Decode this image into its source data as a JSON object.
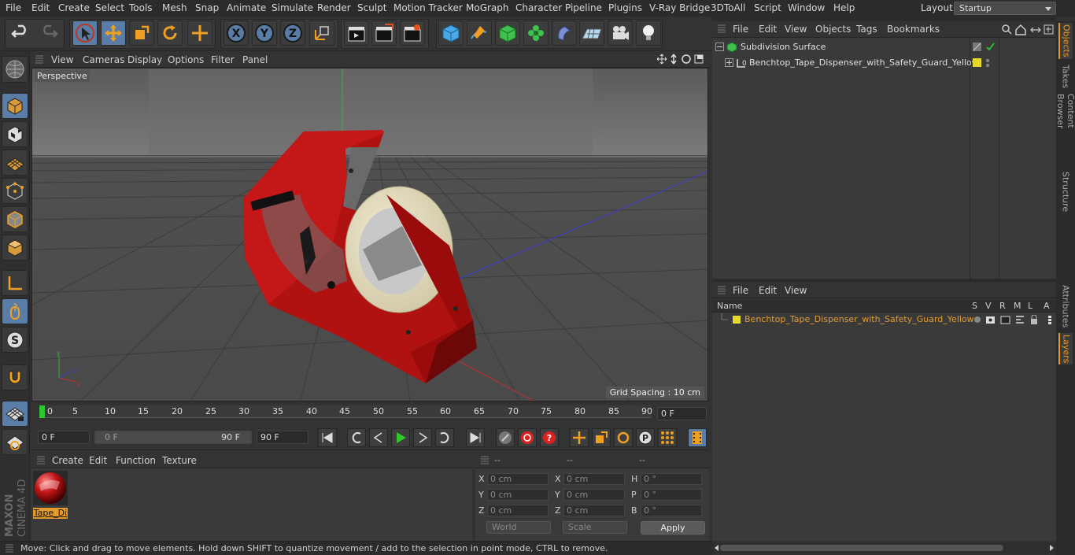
{
  "menubar": {
    "items": [
      "File",
      "Edit",
      "Create",
      "Select",
      "Tools",
      "Mesh",
      "Snap",
      "Animate",
      "Simulate",
      "Render",
      "Sculpt",
      "Motion Tracker",
      "MoGraph",
      "Character",
      "Pipeline",
      "Plugins",
      "V-Ray Bridge",
      "3DToAll",
      "Script",
      "Window",
      "Help"
    ],
    "layout_label": "Layout:",
    "layout_value": "Startup"
  },
  "viewport": {
    "menu": [
      "View",
      "Cameras",
      "Display",
      "Options",
      "Filter",
      "Panel"
    ],
    "camera_label": "Perspective",
    "grid_spacing": "Grid Spacing : 10 cm"
  },
  "timeline": {
    "ticks": [
      "0",
      "5",
      "10",
      "15",
      "20",
      "25",
      "30",
      "35",
      "40",
      "45",
      "50",
      "55",
      "60",
      "65",
      "70",
      "75",
      "80",
      "85",
      "90"
    ],
    "current_frame_field": "0 F"
  },
  "playback": {
    "start_field": "0 F",
    "range_start": "0 F",
    "range_end": "90 F",
    "end_field": "90 F"
  },
  "materials": {
    "menu": [
      "Create",
      "Edit",
      "Function",
      "Texture"
    ],
    "items": [
      {
        "name": "Tape_Di"
      }
    ]
  },
  "coordinates": {
    "headers": [
      "--",
      "--",
      "--"
    ],
    "rows": [
      {
        "l1": "X",
        "v1": "0 cm",
        "l2": "X",
        "v2": "0 cm",
        "l3": "H",
        "v3": "0 °"
      },
      {
        "l1": "Y",
        "v1": "0 cm",
        "l2": "Y",
        "v2": "0 cm",
        "l3": "P",
        "v3": "0 °"
      },
      {
        "l1": "Z",
        "v1": "0 cm",
        "l2": "Z",
        "v2": "0 cm",
        "l3": "B",
        "v3": "0 °"
      }
    ],
    "mode_select": "World",
    "scale_select": "Scale",
    "apply_label": "Apply"
  },
  "status": {
    "text": "Move: Click and drag to move elements. Hold down SHIFT to quantize movement / add to the selection in point mode, CTRL to remove."
  },
  "objects": {
    "menu": [
      "File",
      "Edit",
      "View",
      "Objects",
      "Tags",
      "Bookmarks"
    ],
    "items": [
      {
        "name": "Subdivision Surface"
      },
      {
        "name": "Benchtop_Tape_Dispenser_with_Safety_Guard_Yellow"
      }
    ]
  },
  "layers": {
    "menu": [
      "File",
      "Edit",
      "View"
    ],
    "columns": [
      "Name",
      "S",
      "V",
      "R",
      "M",
      "L",
      "A"
    ],
    "items": [
      {
        "name": "Benchtop_Tape_Dispenser_with_Safety_Guard_Yellow",
        "color": "#e3d92a"
      }
    ]
  },
  "side_tabs": [
    "Objects",
    "Takes",
    "Content Browser",
    "Structure",
    "Attributes",
    "Layers"
  ],
  "brand": {
    "line1": "MAXON",
    "line2": "CINEMA 4D"
  },
  "colors": {
    "accent": "#e59a2d",
    "layer_yellow": "#e3d92a",
    "dispenser_red": "#b01212",
    "selection_blue": "#5a7da8"
  }
}
